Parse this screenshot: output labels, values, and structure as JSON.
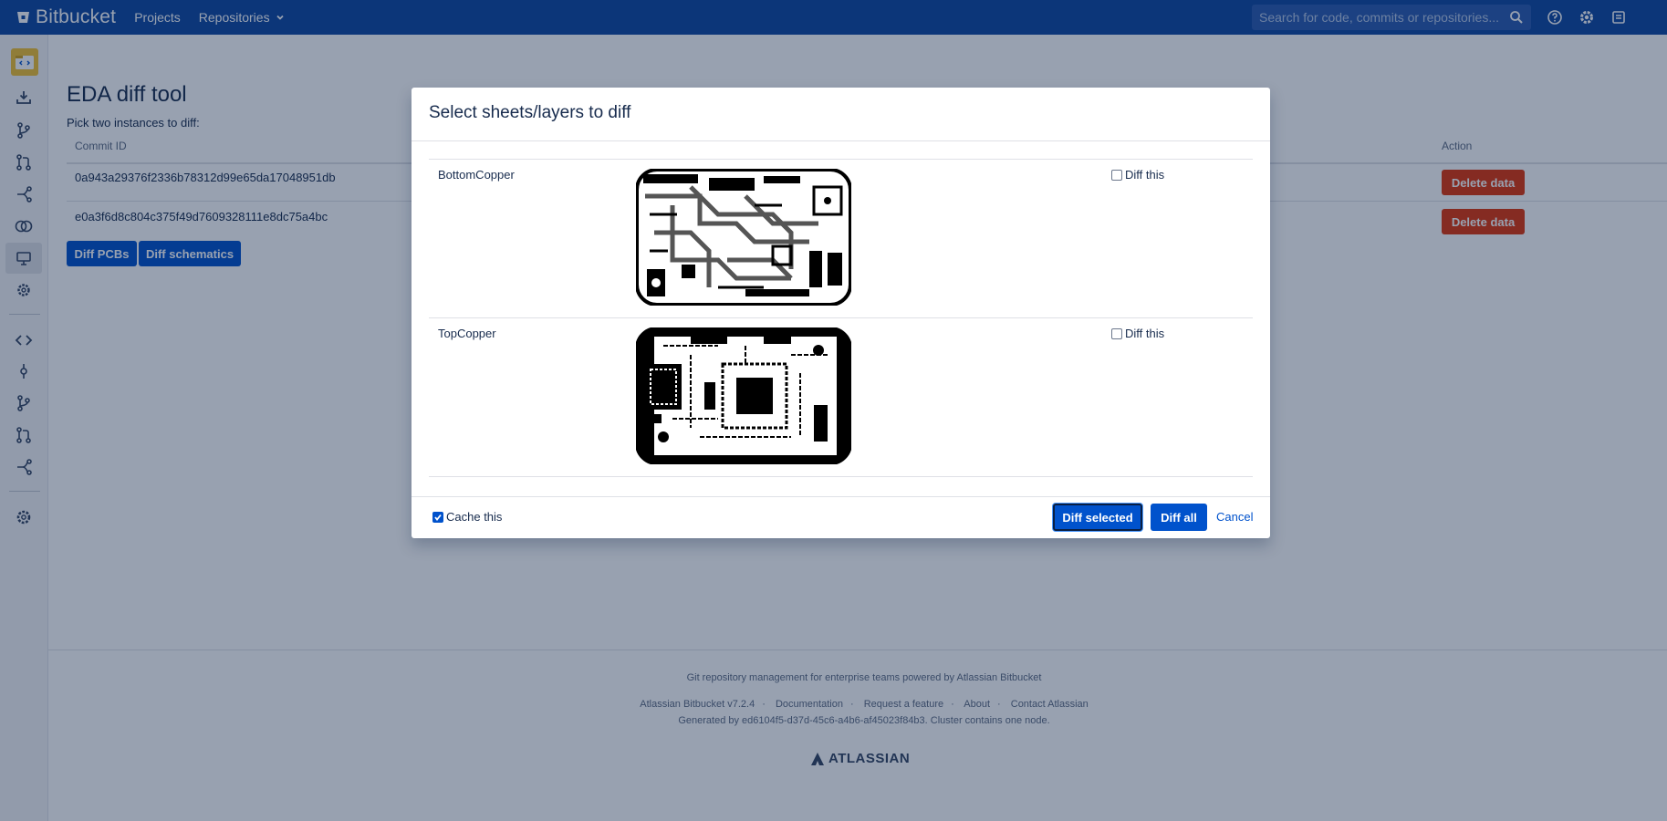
{
  "app": {
    "brand": "Bitbucket",
    "nav": [
      "Projects",
      "Repositories"
    ],
    "search_placeholder": "Search for code, commits or repositories..."
  },
  "page": {
    "title": "EDA diff tool",
    "subtitle": "Pick two instances to diff:",
    "columns": {
      "commit": "Commit ID",
      "action": "Action"
    },
    "rows": [
      {
        "commit": "0a943a29376f2336b78312d99e65da17048951db",
        "action": "Delete data"
      },
      {
        "commit": "e0a3f6d8c804c375f49d7609328111e8dc75a4bc",
        "action": "Delete data"
      }
    ],
    "buttons": {
      "diff_pcbs": "Diff PCBs",
      "diff_schematics": "Diff schematics"
    }
  },
  "dialog": {
    "title": "Select sheets/layers to diff",
    "layers": [
      {
        "name": "BottomCopper",
        "checkbox_label": "Diff this",
        "checked": false
      },
      {
        "name": "TopCopper",
        "checkbox_label": "Diff this",
        "checked": false
      }
    ],
    "cache_label": "Cache this",
    "cache_checked": true,
    "diff_selected": "Diff selected",
    "diff_all": "Diff all",
    "cancel": "Cancel"
  },
  "footer": {
    "tagline": "Git repository management for enterprise teams powered by Atlassian Bitbucket",
    "version": "Atlassian Bitbucket v7.2.4",
    "links": [
      "Documentation",
      "Request a feature",
      "About",
      "Contact Atlassian"
    ],
    "generated": "Generated by ed6104f5-d37d-45c6-a4b6-af45023f84b3. Cluster contains one node.",
    "logo_text": "ATLASSIAN"
  },
  "colors": {
    "topbar": "#0e47a1",
    "primary": "#0052cc",
    "danger": "#de350b"
  }
}
